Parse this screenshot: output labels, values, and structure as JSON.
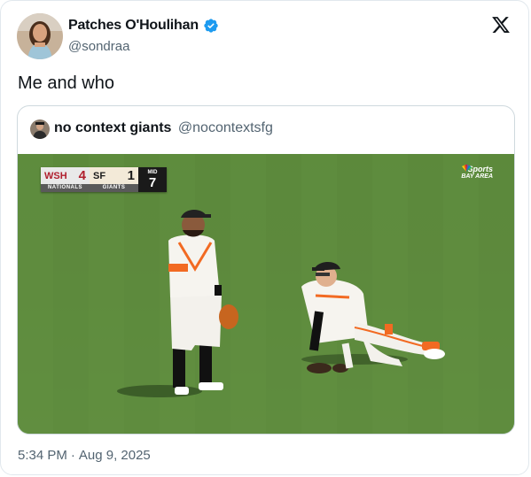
{
  "tweet": {
    "author_name": "Patches O'Houlihan",
    "author_handle": "@sondraa",
    "text": "Me and who",
    "time": "5:34 PM",
    "separator": "·",
    "date": "Aug 9, 2025"
  },
  "quoted_tweet": {
    "author_name": "no context giants",
    "author_handle": "@nocontextsfg",
    "media": {
      "scorebug": {
        "away_abbr": "WSH",
        "away_score": "4",
        "away_name": "NATIONALS",
        "home_abbr": "SF",
        "home_score": "1",
        "home_name": "GIANTS",
        "inning_state": "MID",
        "inning": "7"
      },
      "network_logo": {
        "brand": "Sports",
        "region": "BAY AREA"
      }
    }
  },
  "icons": {
    "verified": "verified-badge-icon",
    "platform": "x-logo-icon"
  },
  "colors": {
    "verified_blue": "#1d9bf0",
    "secondary_text": "#536471",
    "field_green": "#5e8c3e",
    "giants_orange": "#f26a22",
    "nationals_red": "#b01f2e"
  }
}
